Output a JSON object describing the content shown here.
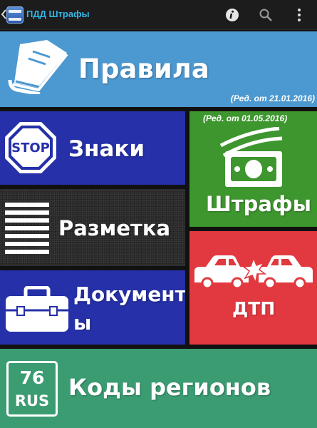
{
  "app": {
    "title": "ПДД Штрафы"
  },
  "tiles": {
    "rules": {
      "label": "Правила",
      "note": "(Ред. от 21.01.2016)"
    },
    "signs": {
      "label": "Знаки",
      "stop_text": "STOP"
    },
    "markup": {
      "label": "Разметка"
    },
    "docs": {
      "label_line1": "Документ",
      "label_line2": "ы"
    },
    "fines": {
      "label": "Штрафы",
      "note": "(Ред. от 01.05.2016)"
    },
    "dtp": {
      "label": "ДТП"
    },
    "codes": {
      "label": "Коды регионов",
      "plate_number": "76",
      "plate_country": "RUS"
    }
  },
  "icons": [
    "chevron-left-icon",
    "app-icon",
    "info-icon",
    "search-icon",
    "overflow-menu-icon",
    "book-icon",
    "stop-sign-icon",
    "road-marking-icon",
    "briefcase-icon",
    "money-icon",
    "car-crash-icon",
    "license-plate-icon"
  ],
  "colors": {
    "actionbar": "#1c1c1c",
    "title": "#33b5e5",
    "rules": "#4c98d0",
    "signs": "#2530a9",
    "docs": "#2530a9",
    "fines": "#3e962f",
    "dtp": "#e1393f",
    "codes": "#3b9c72"
  }
}
